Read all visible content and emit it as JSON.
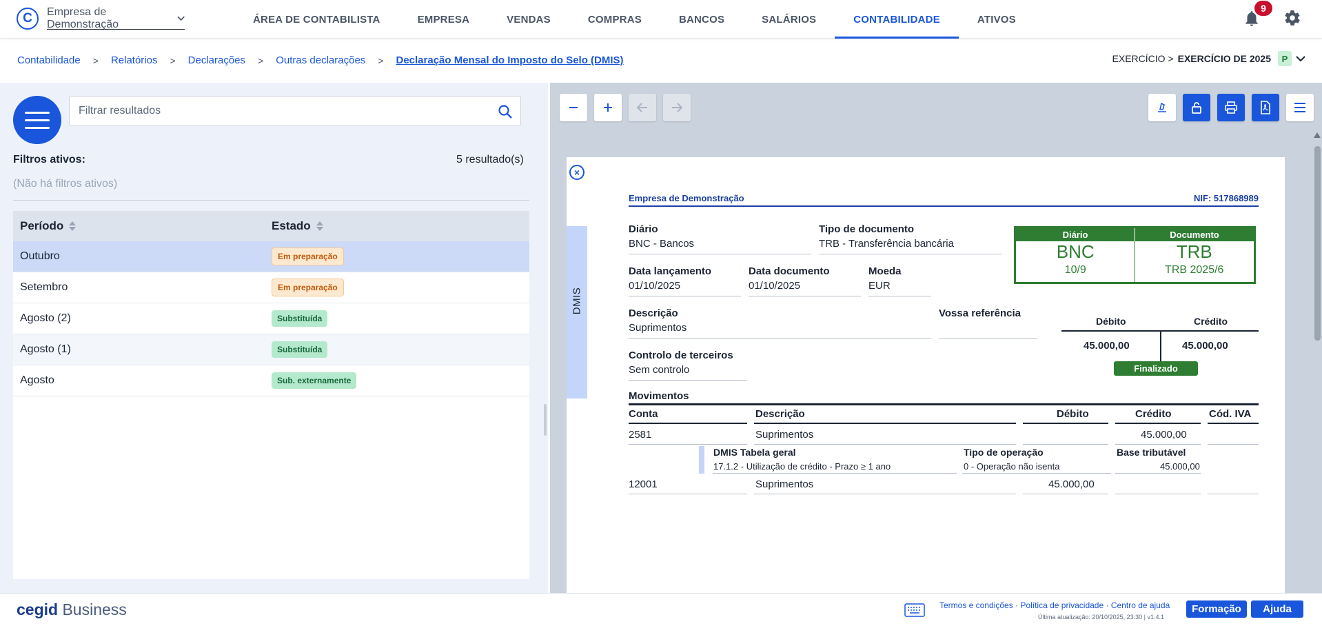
{
  "app": {
    "logo_letter": "C",
    "company": "Empresa de Demonstração"
  },
  "nav": {
    "items": [
      "ÁREA DE CONTABILISTA",
      "EMPRESA",
      "VENDAS",
      "COMPRAS",
      "BANCOS",
      "SALÁRIOS",
      "CONTABILIDADE",
      "ATIVOS"
    ],
    "active": "CONTABILIDADE",
    "notifications_count": "9"
  },
  "breadcrumb": {
    "items": [
      "Contabilidade",
      "Relatórios",
      "Declarações",
      "Outras declarações",
      "Declaração Mensal do Imposto do Selo (DMIS)"
    ],
    "separator": ">"
  },
  "exercise": {
    "prefix": "EXERCÍCIO >",
    "value": "EXERCÍCIO DE 2025",
    "badge": "P"
  },
  "left": {
    "filter_placeholder": "Filtrar resultados",
    "filters_label": "Filtros ativos:",
    "results": "5 resultado(s)",
    "no_filters": "(Não há filtros ativos)",
    "columns": [
      "Período",
      "Estado"
    ],
    "rows": [
      {
        "period": "Outubro",
        "status": "Em preparação",
        "kind": "prep",
        "selected": true
      },
      {
        "period": "Setembro",
        "status": "Em preparação",
        "kind": "prep"
      },
      {
        "period": "Agosto (2)",
        "status": "Substituída",
        "kind": "sub"
      },
      {
        "period": "Agosto (1)",
        "status": "Substituída",
        "kind": "sub"
      },
      {
        "period": "Agosto",
        "status": "Sub. externamente",
        "kind": "sub"
      }
    ]
  },
  "viewer": {
    "side_tab": "DMIS",
    "doc": {
      "company": "Empresa de Demonstração",
      "nif": "NIF: 517868989",
      "diario_label": "Diário",
      "diario_value": "BNC - Bancos",
      "tipo_doc_label": "Tipo de documento",
      "tipo_doc_value": "TRB - Transferência bancária",
      "data_lanc_label": "Data lançamento",
      "data_lanc_value": "01/10/2025",
      "data_doc_label": "Data documento",
      "data_doc_value": "01/10/2025",
      "moeda_label": "Moeda",
      "moeda_value": "EUR",
      "descricao_label": "Descrição",
      "descricao_value": "Suprimentos",
      "vossa_ref_label": "Vossa referência",
      "vossa_ref_value": "",
      "controlo_label": "Controlo de terceiros",
      "controlo_value": "Sem controlo",
      "box": {
        "h_diario": "Diário",
        "h_documento": "Documento",
        "diario_code": "BNC",
        "documento_code": "TRB",
        "diario_num": "10/9",
        "documento_num": "TRB 2025/6"
      },
      "totals": {
        "h_debito": "Débito",
        "h_credito": "Crédito",
        "debito": "45.000,00",
        "credito": "45.000,00"
      },
      "status_badge": "Finalizado",
      "movimentos": {
        "title": "Movimentos",
        "headers": [
          "Conta",
          "Descrição",
          "Débito",
          "Crédito",
          "Cód. IVA"
        ],
        "row1": {
          "conta": "2581",
          "descricao": "Suprimentos",
          "debito": "",
          "credito": "45.000,00",
          "iva": ""
        },
        "sub": {
          "h_tabela": "DMIS Tabela geral",
          "h_operacao": "Tipo de operação",
          "h_base": "Base tributável",
          "v_tabela": "17.1.2 - Utilização de crédito - Prazo ≥ 1 ano",
          "v_operacao": "0 - Operação não isenta",
          "v_base": "45.000,00"
        },
        "row2": {
          "conta": "12001",
          "descricao": "Suprimentos",
          "debito": "45.000,00",
          "credito": "",
          "iva": ""
        }
      }
    }
  },
  "footer": {
    "brand_bold": "cegid",
    "brand_light": "Business",
    "links": [
      "Termos e condições",
      "Política de privacidade",
      "Centro de ajuda"
    ],
    "updated": "Última atualização: 20/10/2025, 23:30 | v1.4.1",
    "btn_formacao": "Formação",
    "btn_ajuda": "Ajuda"
  },
  "colors": {
    "accent": "#1a56db",
    "success": "#2e7d32",
    "warning": "#c2590a"
  }
}
